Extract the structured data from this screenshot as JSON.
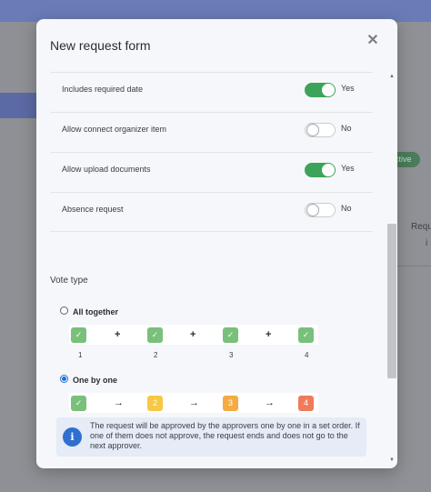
{
  "background": {
    "badge": "ctive",
    "text_line1": "Requ",
    "text_line2": "i"
  },
  "modal": {
    "title": "New request form",
    "close_icon": "close-icon",
    "settings": [
      {
        "label": "Includes required date",
        "on": true,
        "state": "Yes"
      },
      {
        "label": "Allow connect organizer item",
        "on": false,
        "state": "No"
      },
      {
        "label": "Allow upload documents",
        "on": true,
        "state": "Yes"
      },
      {
        "label": "Absence request",
        "on": false,
        "state": "No"
      }
    ],
    "vote_type_label": "Vote type",
    "options": [
      {
        "label": "All together",
        "selected": false,
        "operator": "+",
        "steps": [
          "1",
          "2",
          "3",
          "4"
        ]
      },
      {
        "label": "One by one",
        "selected": true,
        "operator": "→",
        "steps": [
          "",
          "2",
          "3",
          "4"
        ]
      }
    ],
    "info": {
      "icon": "info-icon",
      "glyph": "i",
      "text": "The request will be approved by the approvers one by one in a set order. If one of them does not approve, the request ends and does not go to the next approver."
    }
  },
  "colors": {
    "accent": "#3ea35a",
    "radio_selected": "#1f6fd6",
    "step_green": "#79c07a",
    "step_yellow": "#f6c845",
    "step_orange": "#f4ab42",
    "step_red": "#f07a5a"
  },
  "scrollbar": {
    "up_glyph": "▲",
    "down_glyph": "▼"
  }
}
